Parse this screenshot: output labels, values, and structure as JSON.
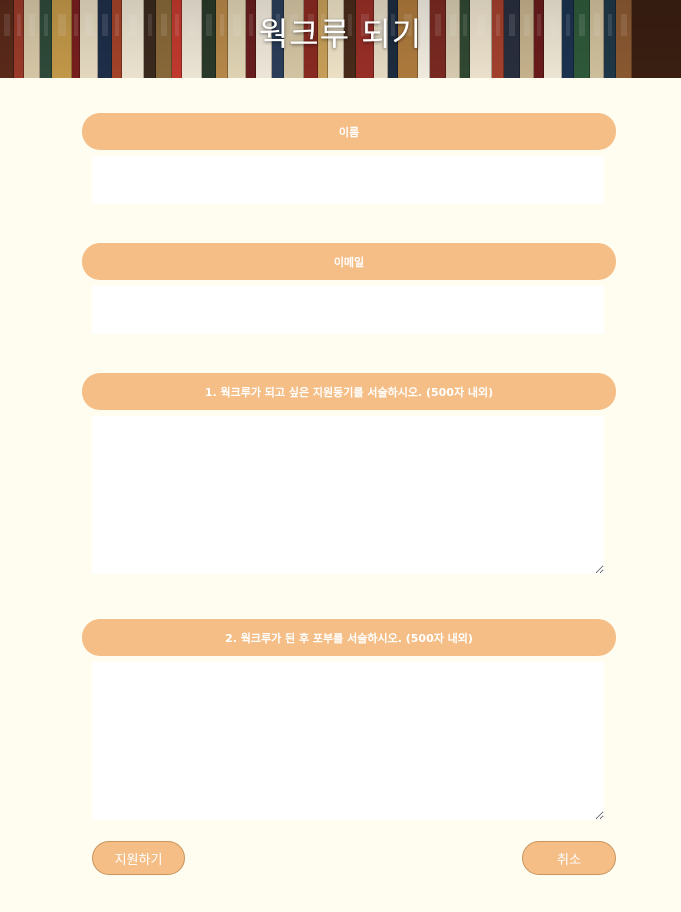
{
  "page": {
    "title": "웍크루 되기"
  },
  "form": {
    "name_label": "이름",
    "name_value": "",
    "email_label": "이메일",
    "email_value": "",
    "question1_label": "1. 웍크루가 되고 싶은 지원동기를 서술하시오. (500자 내외)",
    "question1_value": "",
    "question2_label": "2. 웍크루가 된 후 포부를 서술하시오. (500자 내외)",
    "question2_value": ""
  },
  "actions": {
    "submit_label": "지원하기",
    "cancel_label": "취소"
  },
  "colors": {
    "background": "#fffcf0",
    "accent": "#f5be86",
    "input_background": "#ffffff",
    "title_text": "#ffffff"
  },
  "icons": {
    "header_image": "bookshelf-photo"
  }
}
